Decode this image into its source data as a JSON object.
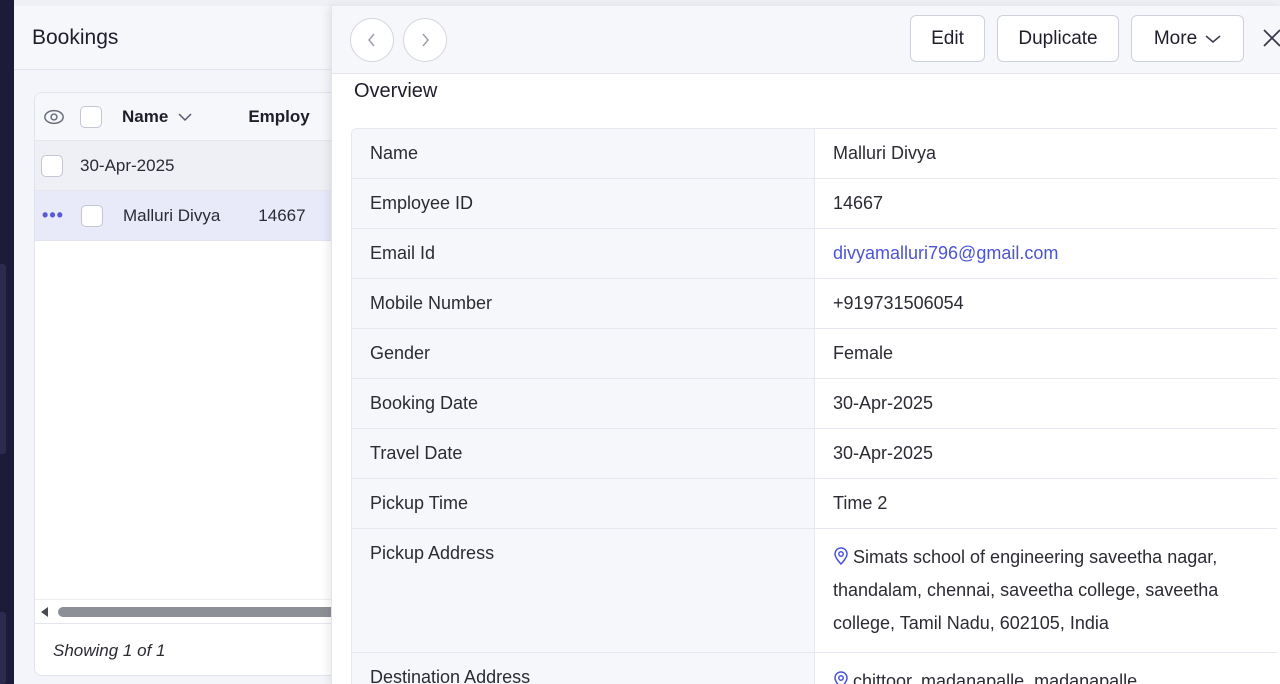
{
  "list": {
    "title": "Bookings",
    "columns": [
      "Name",
      "Employ"
    ],
    "group_label": "30-Apr-2025",
    "row": {
      "name": "Malluri Divya",
      "employee_id": "14667"
    },
    "footer": "Showing 1 of 1"
  },
  "toolbar": {
    "edit_label": "Edit",
    "duplicate_label": "Duplicate",
    "more_label": "More"
  },
  "overview": {
    "title": "Overview",
    "fields": [
      {
        "label": "Name",
        "value": "Malluri Divya"
      },
      {
        "label": "Employee ID",
        "value": "14667"
      },
      {
        "label": "Email Id",
        "value": "divyamalluri796@gmail.com"
      },
      {
        "label": "Mobile Number",
        "value": "+919731506054"
      },
      {
        "label": "Gender",
        "value": "Female"
      },
      {
        "label": "Booking Date",
        "value": "30-Apr-2025"
      },
      {
        "label": "Travel Date",
        "value": "30-Apr-2025"
      },
      {
        "label": "Pickup Time",
        "value": "Time 2"
      },
      {
        "label": "Pickup Address",
        "value": "Simats school of engineering saveetha nagar, thandalam, chennai, saveetha college, saveetha college, Tamil Nadu, 602105, India"
      },
      {
        "label": "Destination Address",
        "value": "chittoor, madanapalle, madanapalle,"
      }
    ]
  },
  "colors": {
    "accent": "#4b54d8",
    "rail": "#1d1b3a",
    "selected_row": "#e8eafa"
  },
  "icons": [
    "eye-icon",
    "chevron-left-icon",
    "chevron-right-icon",
    "chevron-down-icon",
    "close-icon",
    "location-pin-icon",
    "more-dots-icon"
  ]
}
